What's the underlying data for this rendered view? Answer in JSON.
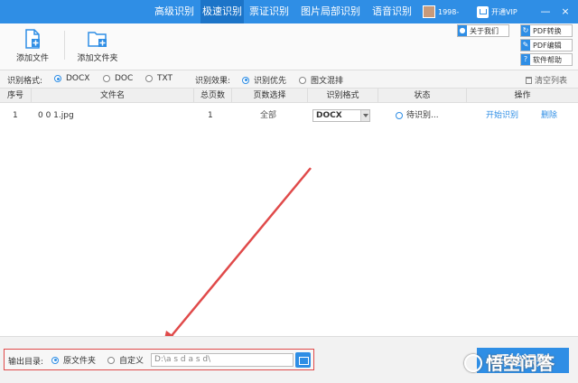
{
  "nav": {
    "tabs": [
      "高级识别",
      "极速识别",
      "票证识别",
      "图片局部识别",
      "语音识别"
    ],
    "active_index": 1,
    "user": "1998-",
    "vip": "开通VIP",
    "minimize": "—",
    "close": "×"
  },
  "toolbar": {
    "add_file": "添加文件",
    "add_folder": "添加文件夹",
    "about": "关于我们",
    "pdf_convert": "PDF转换",
    "pdf_edit": "PDF编辑",
    "help": "软件帮助"
  },
  "options": {
    "format_label": "识别格式:",
    "formats": [
      "DOCX",
      "DOC",
      "TXT"
    ],
    "selected_format": "DOCX",
    "effect_label": "识别效果:",
    "effects": [
      "识别优先",
      "图文混排"
    ],
    "selected_effect": "识别优先",
    "clear_list": "清空列表"
  },
  "table": {
    "columns": [
      "序号",
      "文件名",
      "总页数",
      "页数选择",
      "识别格式",
      "状态",
      "操作"
    ],
    "rows": [
      {
        "index": "1",
        "filename": "0 0 1.jpg",
        "pages": "1",
        "page_select": "全部",
        "format": "DOCX",
        "status": "待识别...",
        "action_start": "开始识别",
        "action_delete": "删除"
      }
    ]
  },
  "output": {
    "label": "输出目录:",
    "option_original": "原文件夹",
    "option_custom": "自定义",
    "selected": "原文件夹",
    "path": "D:\\a s d a s d\\"
  },
  "start_button": "开始识别",
  "watermark": "悟空问答",
  "colors": {
    "accent": "#2f8ee5",
    "annotation": "#e04a4a"
  }
}
